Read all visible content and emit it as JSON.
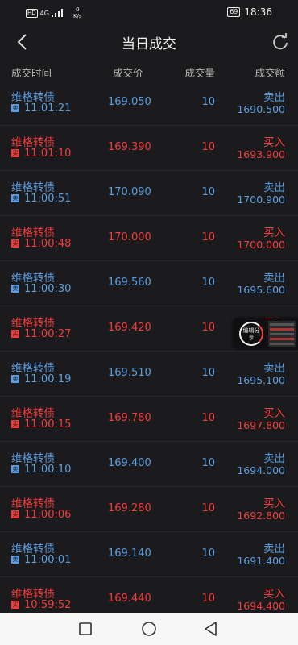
{
  "status_bar": {
    "network": "HD",
    "signal": "4G",
    "speed": "0",
    "speed_unit": "K/s",
    "battery": "69",
    "time": "18:36"
  },
  "header": {
    "title": "当日成交"
  },
  "columns": {
    "time": "成交时间",
    "price": "成交价",
    "volume": "成交量",
    "amount": "成交额"
  },
  "trade_tags": {
    "sell": "卖",
    "buy": "买"
  },
  "trades": [
    {
      "name": "维格转债",
      "time": "11:01:21",
      "price": "169.050",
      "volume": "10",
      "direction": "卖出",
      "amount": "1690.500",
      "side": "sell"
    },
    {
      "name": "维格转债",
      "time": "11:01:10",
      "price": "169.390",
      "volume": "10",
      "direction": "买入",
      "amount": "1693.900",
      "side": "buy"
    },
    {
      "name": "维格转债",
      "time": "11:00:51",
      "price": "170.090",
      "volume": "10",
      "direction": "卖出",
      "amount": "1700.900",
      "side": "sell"
    },
    {
      "name": "维格转债",
      "time": "11:00:48",
      "price": "170.000",
      "volume": "10",
      "direction": "买入",
      "amount": "1700.000",
      "side": "buy"
    },
    {
      "name": "维格转债",
      "time": "11:00:30",
      "price": "169.560",
      "volume": "10",
      "direction": "卖出",
      "amount": "1695.600",
      "side": "sell"
    },
    {
      "name": "维格转债",
      "time": "11:00:27",
      "price": "169.420",
      "volume": "10",
      "direction": "买入",
      "amount": "",
      "side": "buy"
    },
    {
      "name": "维格转债",
      "time": "11:00:19",
      "price": "169.510",
      "volume": "10",
      "direction": "卖出",
      "amount": "1695.100",
      "side": "sell"
    },
    {
      "name": "维格转债",
      "time": "11:00:15",
      "price": "169.780",
      "volume": "10",
      "direction": "买入",
      "amount": "1697.800",
      "side": "buy"
    },
    {
      "name": "维格转债",
      "time": "11:00:10",
      "price": "169.400",
      "volume": "10",
      "direction": "卖出",
      "amount": "1694.000",
      "side": "sell"
    },
    {
      "name": "维格转债",
      "time": "11:00:06",
      "price": "169.280",
      "volume": "10",
      "direction": "买入",
      "amount": "1692.800",
      "side": "buy"
    },
    {
      "name": "维格转债",
      "time": "11:00:01",
      "price": "169.140",
      "volume": "10",
      "direction": "卖出",
      "amount": "1691.400",
      "side": "sell"
    },
    {
      "name": "维格转债",
      "time": "10:59:52",
      "price": "169.440",
      "volume": "10",
      "direction": "买入",
      "amount": "1694.400",
      "side": "buy"
    }
  ],
  "float_widget": {
    "label": "编辑分享"
  },
  "colors": {
    "sell": "#5c9ee0",
    "buy": "#f23d3d",
    "background": "#1b1b1d"
  },
  "icons": {
    "back": "chevron-left-icon",
    "refresh": "refresh-icon",
    "nav_back": "triangle-back-icon",
    "nav_home": "circle-home-icon",
    "nav_recent": "square-recent-icon"
  }
}
